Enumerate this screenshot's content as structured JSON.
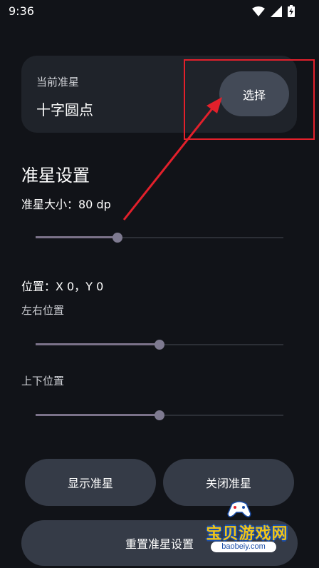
{
  "status_bar": {
    "time": "9:36",
    "icons": [
      "wifi-icon",
      "signal-icon",
      "battery-charging-icon"
    ]
  },
  "current_crosshair": {
    "label": "当前准星",
    "value": "十字圆点",
    "select_button": "选择"
  },
  "settings": {
    "title": "准星设置",
    "size_label": "准星大小：80 dp",
    "size_slider": {
      "value": 0.33
    },
    "position_label": "位置：X 0，Y 0",
    "horizontal_label": "左右位置",
    "horizontal_slider": {
      "value": 0.5
    },
    "vertical_label": "上下位置",
    "vertical_slider": {
      "value": 0.5
    }
  },
  "buttons": {
    "show": "显示准星",
    "close": "关闭准星",
    "reset": "重置准星设置"
  },
  "annotation": {
    "color": "#e3202b"
  },
  "watermark": {
    "text": "宝贝游戏网",
    "url": "baobeiy.com"
  }
}
